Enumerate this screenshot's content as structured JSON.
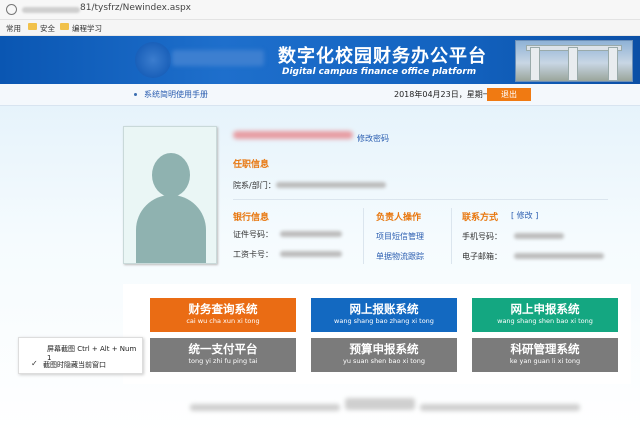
{
  "browser": {
    "url_suffix": "81/tysfrz/Newindex.aspx"
  },
  "bookmarks": [
    {
      "label": "常用"
    },
    {
      "label": "安全"
    },
    {
      "label": "编程学习"
    }
  ],
  "banner": {
    "title_cn": "数字化校园财务办公平台",
    "title_en": "Digital campus finance office platform"
  },
  "topbar": {
    "manual_link": "系统简明使用手册",
    "date": "2018年04月23日，星期一",
    "logout": "退出"
  },
  "profile": {
    "change_password": "修改密码",
    "position_section": "任职信息",
    "department_label": "院系/部门："
  },
  "bank": {
    "section": "银行信息",
    "id_label": "证件号码：",
    "salary_card_label": "工资卡号："
  },
  "manager": {
    "section": "负责人操作",
    "sms_link": "项目短信管理",
    "doc_link": "单据物流跟踪"
  },
  "contact": {
    "section": "联系方式",
    "edit_link": "[ 修改 ]",
    "phone_label": "手机号码：",
    "email_label": "电子邮箱："
  },
  "systems": [
    {
      "cn": "财务查询系统",
      "py": "cai wu cha xun xi tong",
      "color": "#ea6c14"
    },
    {
      "cn": "网上报账系统",
      "py": "wang shang bao zhang xi tong",
      "color": "#1369c1"
    },
    {
      "cn": "网上申报系统",
      "py": "wang shang shen bao xi tong",
      "color": "#14a781"
    },
    {
      "cn": "统一支付平台",
      "py": "tong yi zhi fu ping tai",
      "color": "#7b7b7b"
    },
    {
      "cn": "预算申报系统",
      "py": "yu suan shen bao xi tong",
      "color": "#7b7b7b"
    },
    {
      "cn": "科研管理系统",
      "py": "ke yan guan li xi tong",
      "color": "#7b7b7b"
    }
  ],
  "screenshot_popup": {
    "line1": "屏幕截图 Ctrl + Alt + Num 1",
    "line2": "截图时隐藏当前窗口"
  }
}
